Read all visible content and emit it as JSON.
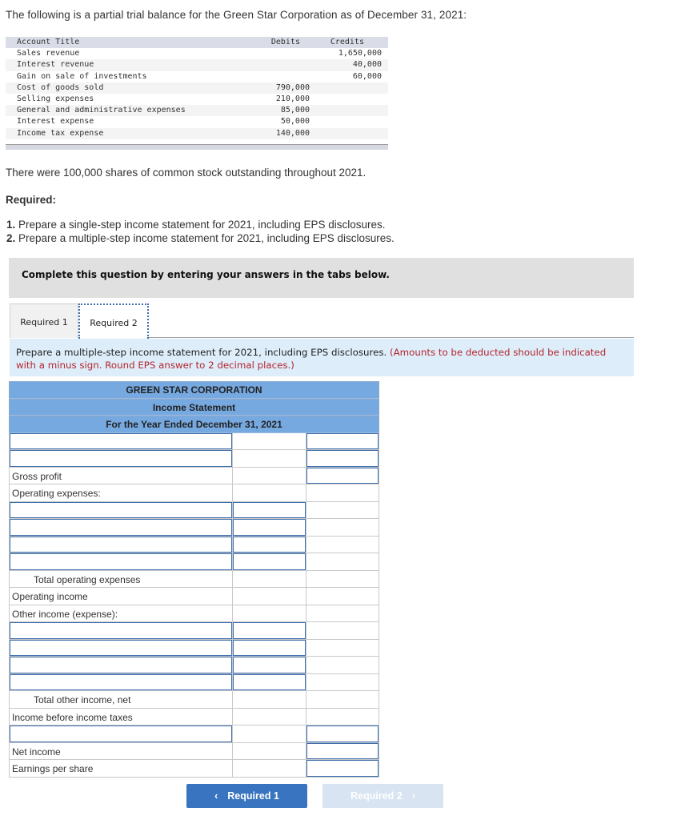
{
  "intro": "The following is a partial trial balance for the Green Star Corporation as of December 31, 2021:",
  "trial_balance": {
    "headers": {
      "title": "Account Title",
      "debits": "Debits",
      "credits": "Credits"
    },
    "rows": [
      {
        "title": "Sales revenue",
        "debit": "",
        "credit": "1,650,000"
      },
      {
        "title": "Interest revenue",
        "debit": "",
        "credit": "40,000"
      },
      {
        "title": "Gain on sale of investments",
        "debit": "",
        "credit": "60,000"
      },
      {
        "title": "Cost of goods sold",
        "debit": "790,000",
        "credit": ""
      },
      {
        "title": "Selling expenses",
        "debit": "210,000",
        "credit": ""
      },
      {
        "title": "General and administrative expenses",
        "debit": "85,000",
        "credit": ""
      },
      {
        "title": "Interest expense",
        "debit": "50,000",
        "credit": ""
      },
      {
        "title": "Income tax expense",
        "debit": "140,000",
        "credit": ""
      }
    ]
  },
  "shares_text": "There were 100,000 shares of common stock outstanding throughout 2021.",
  "required_heading": "Required:",
  "requirements": [
    {
      "num": "1.",
      "text": " Prepare a single-step income statement for 2021, including EPS disclosures."
    },
    {
      "num": "2.",
      "text": " Prepare a multiple-step income statement for 2021, including EPS disclosures."
    }
  ],
  "complete_banner": "Complete this question by entering your answers in the tabs below.",
  "tabs": [
    {
      "label": "Required 1",
      "active": false
    },
    {
      "label": "Required 2",
      "active": true
    }
  ],
  "instruction": {
    "text": "Prepare a multiple-step income statement for 2021, including EPS disclosures. ",
    "note": "(Amounts to be deducted should be indicated with a minus sign. Round EPS answer to 2 decimal places.)"
  },
  "statement": {
    "company": "GREEN STAR CORPORATION",
    "title": "Income Statement",
    "period": "For the Year Ended December 31, 2021",
    "labels": {
      "gross_profit": "Gross profit",
      "operating_expenses": "Operating expenses:",
      "total_operating_expenses": "Total operating expenses",
      "operating_income": "Operating income",
      "other_income": "Other income (expense):",
      "total_other_income": "Total other income, net",
      "income_before_taxes": "Income before income taxes",
      "net_income": "Net income",
      "eps": "Earnings per share"
    },
    "inputs": {
      "value": "",
      "placeholder": ""
    }
  },
  "nav": {
    "prev_label": "Required 1",
    "next_label": "Required 2",
    "prev_icon": "‹",
    "next_icon": "›"
  }
}
